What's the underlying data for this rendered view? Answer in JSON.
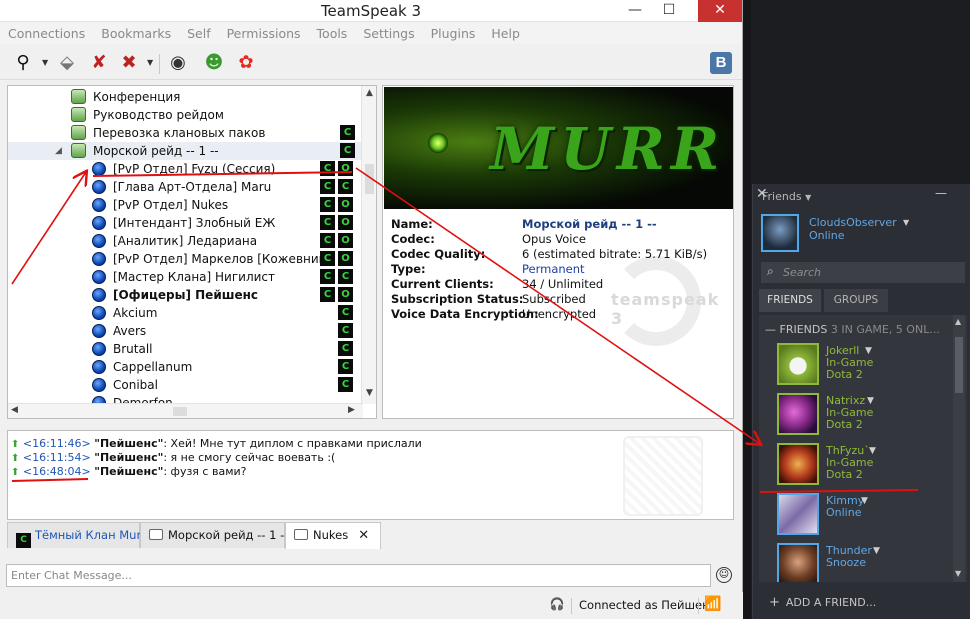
{
  "ts": {
    "title": "TeamSpeak 3",
    "window_controls": {
      "minimize": "—",
      "maximize": "☐",
      "close": "✕"
    },
    "menu": [
      "Connections",
      "Bookmarks",
      "Self",
      "Permissions",
      "Tools",
      "Settings",
      "Plugins",
      "Help"
    ],
    "toolbar_vk": "B",
    "tree": [
      {
        "type": "channel",
        "label": "Конференция"
      },
      {
        "type": "channel",
        "label": "Руководство рейдом"
      },
      {
        "type": "channel",
        "label": "Перевозка клановых паков"
      },
      {
        "type": "channel",
        "label": "Морской рейд -- 1 --",
        "expanded": true
      },
      {
        "type": "user",
        "label": "[PvP Отдел] Fyzu (Сессия)"
      },
      {
        "type": "user",
        "label": "[Глава Арт-Отдела] Maru"
      },
      {
        "type": "user",
        "label": "[PvP Отдел] Nukes"
      },
      {
        "type": "user",
        "label": "[Интендант] Злобный ЕЖ"
      },
      {
        "type": "user",
        "label": "[Аналитик] Ледариана"
      },
      {
        "type": "user",
        "label": "[PvP Отдел] Маркелов [Кожевник]"
      },
      {
        "type": "user",
        "label": "[Мастер Клана] Нигилист"
      },
      {
        "type": "user",
        "label": "[Офицеры] Пейшенс",
        "bold": true
      },
      {
        "type": "user",
        "label": "Akcium"
      },
      {
        "type": "user",
        "label": "Avers"
      },
      {
        "type": "user",
        "label": "Brutall"
      },
      {
        "type": "user",
        "label": "Cappellanum"
      },
      {
        "type": "user",
        "label": "Conibal"
      },
      {
        "type": "user",
        "label": "Demorfon"
      }
    ],
    "banner_logo": "MURR",
    "info": {
      "name_key": "Name:",
      "name_val": "Морской рейд -- 1 --",
      "codec_key": "Codec:",
      "codec_val": "Opus Voice",
      "quality_key": "Codec Quality:",
      "quality_val": "6 (estimated bitrate: 5.71 KiB/s)",
      "type_key": "Type:",
      "type_val": "Permanent",
      "clients_key": "Current Clients:",
      "clients_val": "34 / Unlimited",
      "sub_key": "Subscription Status:",
      "sub_val": "Subscribed",
      "enc_key": "Voice Data Encryption:",
      "enc_val": "Unencrypted"
    },
    "watermark_text": "teamspeak 3",
    "chat": [
      {
        "time": "<16:11:46>",
        "name": "\"Пейшенс\"",
        "msg": ": Хей! Мне тут диплом с правками прислали"
      },
      {
        "time": "<16:11:54>",
        "name": "\"Пейшенс\"",
        "msg": ": я не смогу сейчас воевать :("
      },
      {
        "time": "<16:48:04>",
        "name": "\"Пейшенс\"",
        "msg": ": фузя с вами?"
      }
    ],
    "tabs": [
      "Тёмный Клан Murr",
      "Морской рейд -- 1 --",
      "Nukes"
    ],
    "tab_close": "✕",
    "chat_placeholder": "Enter Chat Message...",
    "status": "Connected as Пейшенс"
  },
  "steam": {
    "title": "Friends",
    "controls": {
      "minimize": "—",
      "close": "✕"
    },
    "me": {
      "name": "CloudsObserver",
      "status": "Online"
    },
    "search_placeholder": "Search",
    "tab_friends": "FRIENDS",
    "tab_groups": "GROUPS",
    "list_head": "FRIENDS",
    "list_head_count": "3 IN GAME, 5 ONL...",
    "friends": [
      {
        "name": "Jokerll",
        "status": "In-Game",
        "game": "Dota 2",
        "in_game": true
      },
      {
        "name": "Natrixz",
        "status": "In-Game",
        "game": "Dota 2",
        "in_game": true
      },
      {
        "name": "ThFyzu`",
        "status": "In-Game",
        "game": "Dota 2",
        "in_game": true
      },
      {
        "name": "Kimmy",
        "status": "Online",
        "game": "",
        "in_game": false
      },
      {
        "name": "Thunder",
        "status": "Snooze",
        "game": "",
        "in_game": false
      }
    ],
    "add_friend": "ADD A FRIEND...",
    "colors": {
      "in_game": "#90ba3c",
      "online": "#62a7e3",
      "snooze": "#62a7e3",
      "bg": "#2b2e34"
    }
  }
}
